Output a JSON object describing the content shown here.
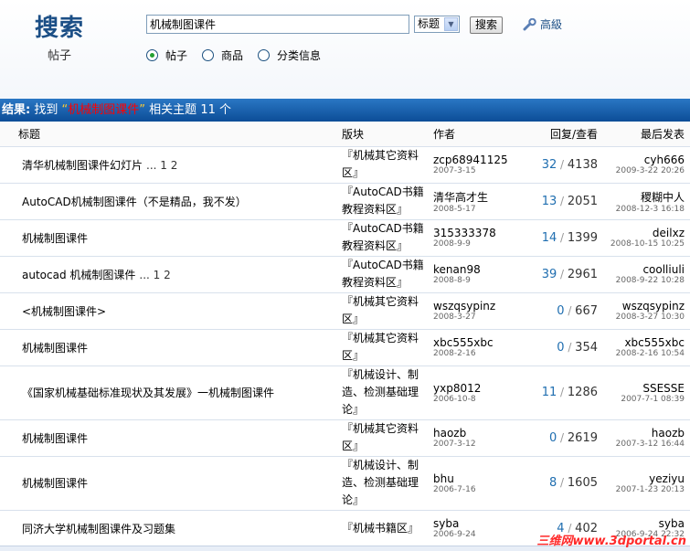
{
  "header": {
    "logo": "搜索",
    "logo_sub": "帖子",
    "search_value": "机械制图课件",
    "scope_select": "标题",
    "search_button": "搜索",
    "advanced": "高級",
    "radios": [
      {
        "label": "帖子",
        "checked": true
      },
      {
        "label": "商品",
        "checked": false
      },
      {
        "label": "分类信息",
        "checked": false
      }
    ]
  },
  "result": {
    "prefix": "结果:",
    "found": "找到",
    "keyword": "机械制图课件",
    "suffix": "相关主题",
    "count": "11 个"
  },
  "table": {
    "headers": {
      "title": "标题",
      "forum": "版块",
      "author": "作者",
      "replies": "回复/查看",
      "last": "最后发表"
    },
    "rows": [
      {
        "title": "清华机械制图课件幻灯片",
        "pages": "... 1 2",
        "forum": "『机械其它资料区』",
        "author": "zcp68941125",
        "author_date": "2007-3-15",
        "replies": "32",
        "views": "4138",
        "last_user": "cyh666",
        "last_date": "2009-3-22 20:26"
      },
      {
        "title": "AutoCAD机械制图课件（不是精品，我不发）",
        "pages": "",
        "forum": "『AutoCAD书籍教程资料区』",
        "author": "清华高才生",
        "author_date": "2008-5-17",
        "replies": "13",
        "views": "2051",
        "last_user": "稷糊中人",
        "last_date": "2008-12-3 16:18"
      },
      {
        "title": "机械制图课件",
        "pages": "",
        "forum": "『AutoCAD书籍教程资料区』",
        "author": "315333378",
        "author_date": "2008-9-9",
        "replies": "14",
        "views": "1399",
        "last_user": "deilxz",
        "last_date": "2008-10-15 10:25"
      },
      {
        "title": "autocad 机械制图课件",
        "pages": "... 1 2",
        "forum": "『AutoCAD书籍教程资料区』",
        "author": "kenan98",
        "author_date": "2008-8-9",
        "replies": "39",
        "views": "2961",
        "last_user": "coolliuli",
        "last_date": "2008-9-22 10:28"
      },
      {
        "title": "<机械制图课件>",
        "pages": "",
        "forum": "『机械其它资料区』",
        "author": "wszqsypinz",
        "author_date": "2008-3-27",
        "replies": "0",
        "views": "667",
        "last_user": "wszqsypinz",
        "last_date": "2008-3-27 10:30"
      },
      {
        "title": "机械制图课件",
        "pages": "",
        "forum": "『机械其它资料区』",
        "author": "xbc555xbc",
        "author_date": "2008-2-16",
        "replies": "0",
        "views": "354",
        "last_user": "xbc555xbc",
        "last_date": "2008-2-16 10:54"
      },
      {
        "title": "《国家机械基础标准现状及其发展》一机械制图课件",
        "pages": "",
        "forum": "『机械设计、制造、检测基础理论』",
        "author": "yxp8012",
        "author_date": "2006-10-8",
        "replies": "11",
        "views": "1286",
        "last_user": "SSESSE",
        "last_date": "2007-7-1 08:39"
      },
      {
        "title": "机械制图课件",
        "pages": "",
        "forum": "『机械其它资料区』",
        "author": "haozb",
        "author_date": "2007-3-12",
        "replies": "0",
        "views": "2619",
        "last_user": "haozb",
        "last_date": "2007-3-12 16:44"
      },
      {
        "title": "机械制图课件",
        "pages": "",
        "forum": "『机械设计、制造、检测基础理论』",
        "author": "bhu",
        "author_date": "2006-7-16",
        "replies": "8",
        "views": "1605",
        "last_user": "yeziyu",
        "last_date": "2007-1-23 20:13"
      },
      {
        "title": "同济大学机械制图课件及习题集",
        "pages": "",
        "forum": "『机械书籍区』",
        "author": "syba",
        "author_date": "2006-9-24",
        "replies": "4",
        "views": "402",
        "last_user": "syba",
        "last_date": "2006-9-24 22:32"
      }
    ]
  },
  "watermark": "三维网www.3dportal.cn"
}
